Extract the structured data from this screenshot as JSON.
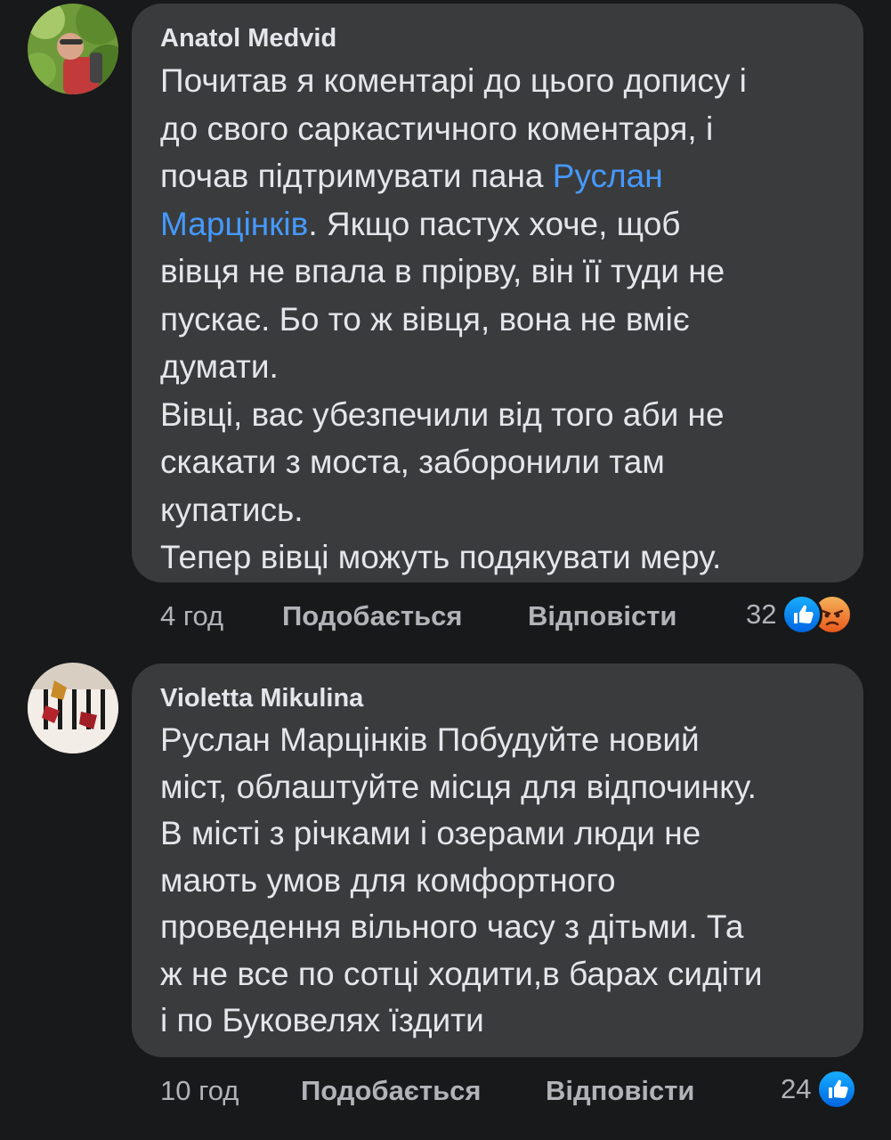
{
  "comments": [
    {
      "author": "Anatol Medvid",
      "lines": [
        [
          "Почитав я коментарі до цього допису і"
        ],
        [
          "до свого саркастичного коментаря, і"
        ],
        [
          "почав підтримувати пана ",
          "Руслан"
        ],
        [
          "Марцінків",
          ". Якщо пастух хоче, щоб"
        ],
        [
          "вівця не впала в прірву, він її туди не"
        ],
        [
          "пускає. Бо то ж вівця, вона не вміє"
        ],
        [
          "думати."
        ],
        [
          "Вівці, вас убезпечили від того аби не"
        ],
        [
          "скакати з моста, заборонили там"
        ],
        [
          "купатись."
        ],
        [
          "Тепер вівці можуть подякувати меру."
        ]
      ],
      "mention": "Руслан Марцінків",
      "time": "4 год",
      "like_label": "Подобається",
      "reply_label": "Відповісти",
      "reaction_count": "32",
      "reactions": [
        "like-icon",
        "angry-icon"
      ]
    },
    {
      "author": "Violetta Mikulina",
      "lines": [
        "Руслан Марцінків Побудуйте новий",
        "міст, облаштуйте місця для відпочинку.",
        "В місті з річками і озерами люди не",
        "мають умов для комфортного",
        "проведення вільного часу з дітьми. Та",
        "ж не все по сотці ходити,в барах сидіти",
        "і по Буковелях їздити"
      ],
      "time": "10 год",
      "like_label": "Подобається",
      "reply_label": "Відповісти",
      "reaction_count": "24",
      "reactions": [
        "like-icon"
      ]
    }
  ],
  "colors": {
    "background": "#18191a",
    "bubble": "#3a3b3c",
    "text": "#e4e6eb",
    "secondary": "#b0b3b8",
    "mention": "#4599ff",
    "like": "#1877f2",
    "angry": "#e9591b"
  }
}
